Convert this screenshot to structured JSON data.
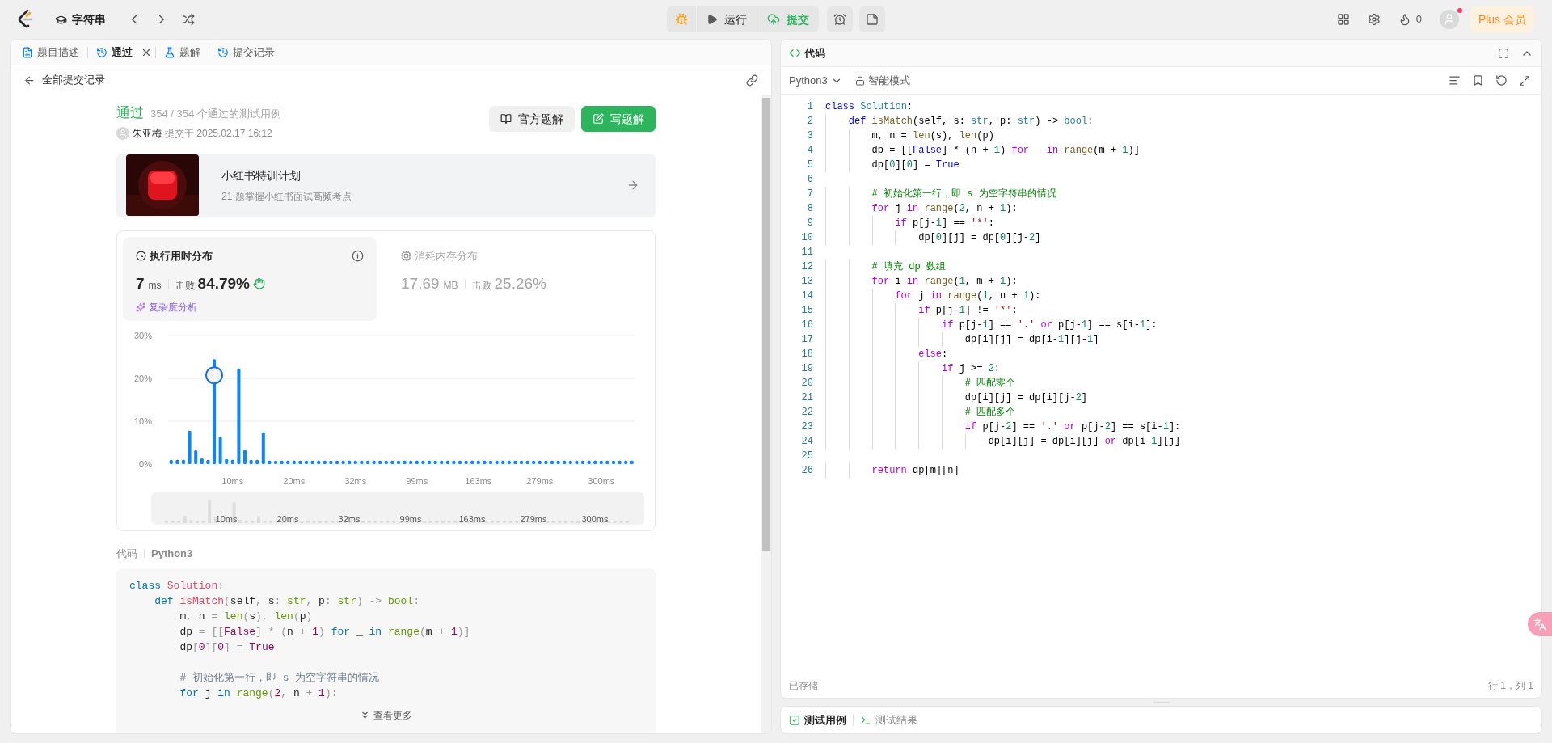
{
  "top_bar": {
    "problem_title": "字符串",
    "run_label": "运行",
    "submit_label": "提交",
    "fire_count": "0",
    "plus_label": "Plus 会员",
    "avatar_notification": true
  },
  "left_tabs": [
    {
      "label": "题目描述",
      "selected": false,
      "closable": false
    },
    {
      "label": "通过",
      "selected": true,
      "closable": true
    },
    {
      "label": "题解",
      "selected": false,
      "closable": false
    },
    {
      "label": "提交记录",
      "selected": false,
      "closable": false
    }
  ],
  "back_link": "全部提交记录",
  "submission": {
    "status": "通过",
    "cases": "354 / 354 个通过的测试用例",
    "author": "朱亚梅",
    "submitted": "提交于 2025.02.17 16:12",
    "buttons": [
      {
        "label": "官方题解",
        "kind": "secondary"
      },
      {
        "label": "写题解",
        "kind": "primary"
      }
    ]
  },
  "promo": {
    "title": "小红书特训计划",
    "subtitle": "21 题掌握小红书面试高频考点"
  },
  "stats": [
    {
      "title": "执行用时分布",
      "selected": true,
      "value": "7",
      "unit": "ms",
      "beats_label": "击败",
      "beats": "84.79%",
      "link": "复杂度分析"
    },
    {
      "title": "消耗内存分布",
      "selected": false,
      "value": "17.69",
      "unit": "MB",
      "beats_label": "击败",
      "beats": "25.26%"
    }
  ],
  "runtime_chart": {
    "chart_data": {
      "type": "bar",
      "ylim": [
        0,
        30
      ],
      "yticks": [
        {
          "value": 0,
          "label": "0%"
        },
        {
          "value": 10,
          "label": "10%"
        },
        {
          "value": 20,
          "label": "20%"
        },
        {
          "value": 30,
          "label": "30%"
        }
      ],
      "categories": [
        null,
        null,
        null,
        null,
        null,
        null,
        null,
        null,
        null,
        null,
        "10ms",
        null,
        null,
        null,
        null,
        null,
        null,
        null,
        null,
        null,
        "20ms",
        null,
        null,
        null,
        null,
        null,
        null,
        null,
        null,
        null,
        "32ms",
        null,
        null,
        null,
        null,
        null,
        null,
        null,
        null,
        null,
        "99ms",
        null,
        null,
        null,
        null,
        null,
        null,
        null,
        null,
        null,
        "163ms",
        null,
        null,
        null,
        null,
        null,
        null,
        null,
        null,
        null,
        "279ms",
        null,
        null,
        null,
        null,
        null,
        null,
        null,
        null,
        null,
        "300ms",
        null,
        null,
        null,
        null,
        null
      ],
      "values": [
        1,
        1,
        1,
        7.8,
        3.2,
        1.3,
        1,
        24.5,
        6.3,
        1.2,
        1,
        22.3,
        3.4,
        1,
        1,
        7.4,
        0.8,
        0.8,
        0.8,
        0.8,
        0.8,
        0.8,
        0.8,
        0.8,
        0.8,
        0.8,
        0.8,
        0.8,
        0.8,
        0.8,
        0.8,
        0.8,
        0.8,
        0.8,
        0.8,
        0.8,
        0.8,
        0.8,
        0.8,
        0.8,
        0.8,
        0.8,
        0.8,
        0.8,
        0.8,
        0.8,
        0.8,
        0.8,
        0.8,
        0.8,
        0.8,
        0.8,
        0.8,
        0.8,
        0.8,
        0.8,
        0.8,
        0.8,
        0.8,
        0.8,
        0.8,
        0.8,
        0.8,
        0.8,
        0.8,
        0.8,
        0.8,
        0.8,
        0.8,
        0.8,
        0.8,
        0.8,
        0.8,
        0.8,
        0.8,
        0.8
      ]
    },
    "brush_labels": [
      "10ms",
      "20ms",
      "32ms",
      "99ms",
      "163ms",
      "279ms",
      "300ms"
    ]
  },
  "code_preview": {
    "label": "代码",
    "language": "Python3",
    "more": "查看更多",
    "lines": [
      {
        "kind": "code",
        "tokens": [
          {
            "text": "class",
            "kind": "decl"
          },
          {
            "text": " Solution",
            "kind": "cls"
          },
          {
            "text": ":",
            "kind": "punc"
          }
        ]
      },
      {
        "kind": "code",
        "tokens": [
          {
            "text": "    def",
            "kind": "decl"
          },
          {
            "text": " isMatch",
            "kind": "fn"
          },
          {
            "text": "(",
            "kind": "punc"
          },
          {
            "text": "self",
            "kind": "text"
          },
          {
            "text": ", ",
            "kind": "punc"
          },
          {
            "text": "s",
            "kind": "text"
          },
          {
            "text": ": ",
            "kind": "punc"
          },
          {
            "text": "str",
            "kind": "type"
          },
          {
            "text": ", ",
            "kind": "punc"
          },
          {
            "text": "p",
            "kind": "text"
          },
          {
            "text": ": ",
            "kind": "punc"
          },
          {
            "text": "str",
            "kind": "type"
          },
          {
            "text": ") -> ",
            "kind": "punc"
          },
          {
            "text": "bool",
            "kind": "type"
          },
          {
            "text": ":",
            "kind": "punc"
          }
        ]
      },
      {
        "kind": "code",
        "tokens": [
          {
            "text": "        m",
            "kind": "text"
          },
          {
            "text": ", ",
            "kind": "punc"
          },
          {
            "text": "n ",
            "kind": "text"
          },
          {
            "text": "= ",
            "kind": "punc"
          },
          {
            "text": "len",
            "kind": "call"
          },
          {
            "text": "(",
            "kind": "punc"
          },
          {
            "text": "s",
            "kind": "text"
          },
          {
            "text": "), ",
            "kind": "punc"
          },
          {
            "text": "len",
            "kind": "call"
          },
          {
            "text": "(",
            "kind": "punc"
          },
          {
            "text": "p",
            "kind": "text"
          },
          {
            "text": ")",
            "kind": "punc"
          }
        ]
      },
      {
        "kind": "code",
        "tokens": [
          {
            "text": "        dp ",
            "kind": "text"
          },
          {
            "text": "= [[",
            "kind": "punc"
          },
          {
            "text": "False",
            "kind": "const"
          },
          {
            "text": "] * (",
            "kind": "punc"
          },
          {
            "text": "n ",
            "kind": "text"
          },
          {
            "text": "+ ",
            "kind": "punc"
          },
          {
            "text": "1",
            "kind": "num"
          },
          {
            "text": ") ",
            "kind": "punc"
          },
          {
            "text": "for",
            "kind": "kw"
          },
          {
            "text": " _ ",
            "kind": "text"
          },
          {
            "text": "in",
            "kind": "kw"
          },
          {
            "text": " range",
            "kind": "call"
          },
          {
            "text": "(",
            "kind": "punc"
          },
          {
            "text": "m ",
            "kind": "text"
          },
          {
            "text": "+ ",
            "kind": "punc"
          },
          {
            "text": "1",
            "kind": "num"
          },
          {
            "text": ")]",
            "kind": "punc"
          }
        ]
      },
      {
        "kind": "code",
        "tokens": [
          {
            "text": "        dp",
            "kind": "text"
          },
          {
            "text": "[",
            "kind": "punc"
          },
          {
            "text": "0",
            "kind": "num"
          },
          {
            "text": "][",
            "kind": "punc"
          },
          {
            "text": "0",
            "kind": "num"
          },
          {
            "text": "] = ",
            "kind": "punc"
          },
          {
            "text": "True",
            "kind": "const"
          }
        ]
      },
      {
        "kind": "blank"
      },
      {
        "kind": "code",
        "tokens": [
          {
            "text": "        # 初始化第一行，即 s 为空字符串的情况",
            "kind": "cmt"
          }
        ]
      },
      {
        "kind": "code",
        "tokens": [
          {
            "text": "        for",
            "kind": "kw"
          },
          {
            "text": " j ",
            "kind": "text"
          },
          {
            "text": "in",
            "kind": "kw"
          },
          {
            "text": " range",
            "kind": "call"
          },
          {
            "text": "(",
            "kind": "punc"
          },
          {
            "text": "2",
            "kind": "num"
          },
          {
            "text": ", ",
            "kind": "punc"
          },
          {
            "text": "n ",
            "kind": "text"
          },
          {
            "text": "+ ",
            "kind": "punc"
          },
          {
            "text": "1",
            "kind": "num"
          },
          {
            "text": "):",
            "kind": "punc"
          }
        ]
      }
    ]
  },
  "editor": {
    "title": "代码",
    "language": "Python3",
    "mode": "智能模式",
    "saved": "已存储",
    "cursor": "行 1，列 1",
    "lines": [
      {
        "number": "1",
        "tokens": [
          {
            "text": "class",
            "kind": "decl"
          },
          {
            "text": " Solution",
            "kind": "cls"
          },
          {
            "text": ":",
            "kind": "text"
          }
        ]
      },
      {
        "number": "2",
        "tokens": [
          {
            "text": "    def",
            "kind": "decl"
          },
          {
            "text": " isMatch",
            "kind": "fn"
          },
          {
            "text": "(self, s: ",
            "kind": "text"
          },
          {
            "text": "str",
            "kind": "type"
          },
          {
            "text": ", p: ",
            "kind": "text"
          },
          {
            "text": "str",
            "kind": "type"
          },
          {
            "text": ") -> ",
            "kind": "text"
          },
          {
            "text": "bool",
            "kind": "type"
          },
          {
            "text": ":",
            "kind": "text"
          }
        ]
      },
      {
        "number": "3",
        "tokens": [
          {
            "text": "        m, n = ",
            "kind": "text"
          },
          {
            "text": "len",
            "kind": "call"
          },
          {
            "text": "(s), ",
            "kind": "text"
          },
          {
            "text": "len",
            "kind": "call"
          },
          {
            "text": "(p)",
            "kind": "text"
          }
        ]
      },
      {
        "number": "4",
        "tokens": [
          {
            "text": "        dp = [[",
            "kind": "text"
          },
          {
            "text": "False",
            "kind": "const"
          },
          {
            "text": "] * (n + ",
            "kind": "text"
          },
          {
            "text": "1",
            "kind": "num"
          },
          {
            "text": ") ",
            "kind": "text"
          },
          {
            "text": "for",
            "kind": "kw"
          },
          {
            "text": " _ ",
            "kind": "text"
          },
          {
            "text": "in",
            "kind": "kw"
          },
          {
            "text": " range",
            "kind": "call"
          },
          {
            "text": "(m + ",
            "kind": "text"
          },
          {
            "text": "1",
            "kind": "num"
          },
          {
            "text": ")]",
            "kind": "text"
          }
        ]
      },
      {
        "number": "5",
        "tokens": [
          {
            "text": "        dp[",
            "kind": "text"
          },
          {
            "text": "0",
            "kind": "num"
          },
          {
            "text": "][",
            "kind": "text"
          },
          {
            "text": "0",
            "kind": "num"
          },
          {
            "text": "] = ",
            "kind": "text"
          },
          {
            "text": "True",
            "kind": "const"
          }
        ]
      },
      {
        "number": "6"
      },
      {
        "number": "7",
        "tokens": [
          {
            "text": "        # 初始化第一行，即 s 为空字符串的情况",
            "kind": "cmt"
          }
        ]
      },
      {
        "number": "8",
        "tokens": [
          {
            "text": "        for",
            "kind": "kw"
          },
          {
            "text": " j ",
            "kind": "text"
          },
          {
            "text": "in",
            "kind": "kw"
          },
          {
            "text": " range",
            "kind": "call"
          },
          {
            "text": "(",
            "kind": "text"
          },
          {
            "text": "2",
            "kind": "num"
          },
          {
            "text": ", n + ",
            "kind": "text"
          },
          {
            "text": "1",
            "kind": "num"
          },
          {
            "text": "):",
            "kind": "text"
          }
        ]
      },
      {
        "number": "9",
        "tokens": [
          {
            "text": "            if",
            "kind": "kw"
          },
          {
            "text": " p[j-",
            "kind": "text"
          },
          {
            "text": "1",
            "kind": "num"
          },
          {
            "text": "] == ",
            "kind": "text"
          },
          {
            "text": "'*'",
            "kind": "str"
          },
          {
            "text": ":",
            "kind": "text"
          }
        ]
      },
      {
        "number": "10",
        "tokens": [
          {
            "text": "                dp[",
            "kind": "text"
          },
          {
            "text": "0",
            "kind": "num"
          },
          {
            "text": "][j] = dp[",
            "kind": "text"
          },
          {
            "text": "0",
            "kind": "num"
          },
          {
            "text": "][j-",
            "kind": "text"
          },
          {
            "text": "2",
            "kind": "num"
          },
          {
            "text": "]",
            "kind": "text"
          }
        ]
      },
      {
        "number": "11"
      },
      {
        "number": "12",
        "tokens": [
          {
            "text": "        # 填充 dp 数组",
            "kind": "cmt"
          }
        ]
      },
      {
        "number": "13",
        "tokens": [
          {
            "text": "        for",
            "kind": "kw"
          },
          {
            "text": " i ",
            "kind": "text"
          },
          {
            "text": "in",
            "kind": "kw"
          },
          {
            "text": " range",
            "kind": "call"
          },
          {
            "text": "(",
            "kind": "text"
          },
          {
            "text": "1",
            "kind": "num"
          },
          {
            "text": ", m + ",
            "kind": "text"
          },
          {
            "text": "1",
            "kind": "num"
          },
          {
            "text": "):",
            "kind": "text"
          }
        ]
      },
      {
        "number": "14",
        "tokens": [
          {
            "text": "            for",
            "kind": "kw"
          },
          {
            "text": " j ",
            "kind": "text"
          },
          {
            "text": "in",
            "kind": "kw"
          },
          {
            "text": " range",
            "kind": "call"
          },
          {
            "text": "(",
            "kind": "text"
          },
          {
            "text": "1",
            "kind": "num"
          },
          {
            "text": ", n + ",
            "kind": "text"
          },
          {
            "text": "1",
            "kind": "num"
          },
          {
            "text": "):",
            "kind": "text"
          }
        ]
      },
      {
        "number": "15",
        "tokens": [
          {
            "text": "                if",
            "kind": "kw"
          },
          {
            "text": " p[j-",
            "kind": "text"
          },
          {
            "text": "1",
            "kind": "num"
          },
          {
            "text": "] != ",
            "kind": "text"
          },
          {
            "text": "'*'",
            "kind": "str"
          },
          {
            "text": ":",
            "kind": "text"
          }
        ]
      },
      {
        "number": "16",
        "tokens": [
          {
            "text": "                    if",
            "kind": "kw"
          },
          {
            "text": " p[j-",
            "kind": "text"
          },
          {
            "text": "1",
            "kind": "num"
          },
          {
            "text": "] == ",
            "kind": "text"
          },
          {
            "text": "'.'",
            "kind": "str"
          },
          {
            "text": " or",
            "kind": "kw"
          },
          {
            "text": " p[j-",
            "kind": "text"
          },
          {
            "text": "1",
            "kind": "num"
          },
          {
            "text": "] == s[i-",
            "kind": "text"
          },
          {
            "text": "1",
            "kind": "num"
          },
          {
            "text": "]:",
            "kind": "text"
          }
        ]
      },
      {
        "number": "17",
        "tokens": [
          {
            "text": "                        dp[i][j] = dp[i-",
            "kind": "text"
          },
          {
            "text": "1",
            "kind": "num"
          },
          {
            "text": "][j-",
            "kind": "text"
          },
          {
            "text": "1",
            "kind": "num"
          },
          {
            "text": "]",
            "kind": "text"
          }
        ]
      },
      {
        "number": "18",
        "tokens": [
          {
            "text": "                else",
            "kind": "kw"
          },
          {
            "text": ":",
            "kind": "text"
          }
        ]
      },
      {
        "number": "19",
        "tokens": [
          {
            "text": "                    if",
            "kind": "kw"
          },
          {
            "text": " j >= ",
            "kind": "text"
          },
          {
            "text": "2",
            "kind": "num"
          },
          {
            "text": ":",
            "kind": "text"
          }
        ]
      },
      {
        "number": "20",
        "tokens": [
          {
            "text": "                        # 匹配零个",
            "kind": "cmt"
          }
        ]
      },
      {
        "number": "21",
        "tokens": [
          {
            "text": "                        dp[i][j] = dp[i][j-",
            "kind": "text"
          },
          {
            "text": "2",
            "kind": "num"
          },
          {
            "text": "]",
            "kind": "text"
          }
        ]
      },
      {
        "number": "22",
        "tokens": [
          {
            "text": "                        # 匹配多个",
            "kind": "cmt"
          }
        ]
      },
      {
        "number": "23",
        "tokens": [
          {
            "text": "                        if",
            "kind": "kw"
          },
          {
            "text": " p[j-",
            "kind": "text"
          },
          {
            "text": "2",
            "kind": "num"
          },
          {
            "text": "] == ",
            "kind": "text"
          },
          {
            "text": "'.'",
            "kind": "str"
          },
          {
            "text": " or",
            "kind": "kw"
          },
          {
            "text": " p[j-",
            "kind": "text"
          },
          {
            "text": "2",
            "kind": "num"
          },
          {
            "text": "] == s[i-",
            "kind": "text"
          },
          {
            "text": "1",
            "kind": "num"
          },
          {
            "text": "]:",
            "kind": "text"
          }
        ]
      },
      {
        "number": "24",
        "tokens": [
          {
            "text": "                            dp[i][j] = dp[i][j]",
            "kind": "text"
          },
          {
            "text": " or",
            "kind": "kw"
          },
          {
            "text": " dp[i-",
            "kind": "text"
          },
          {
            "text": "1",
            "kind": "num"
          },
          {
            "text": "][j]",
            "kind": "text"
          }
        ]
      },
      {
        "number": "25"
      },
      {
        "number": "26",
        "tokens": [
          {
            "text": "        return",
            "kind": "kw"
          },
          {
            "text": " dp[m][n]",
            "kind": "text"
          }
        ]
      }
    ]
  },
  "bottom_tabs": [
    {
      "label": "测试用例",
      "selected": true
    },
    {
      "label": "测试结果",
      "selected": false
    }
  ]
}
